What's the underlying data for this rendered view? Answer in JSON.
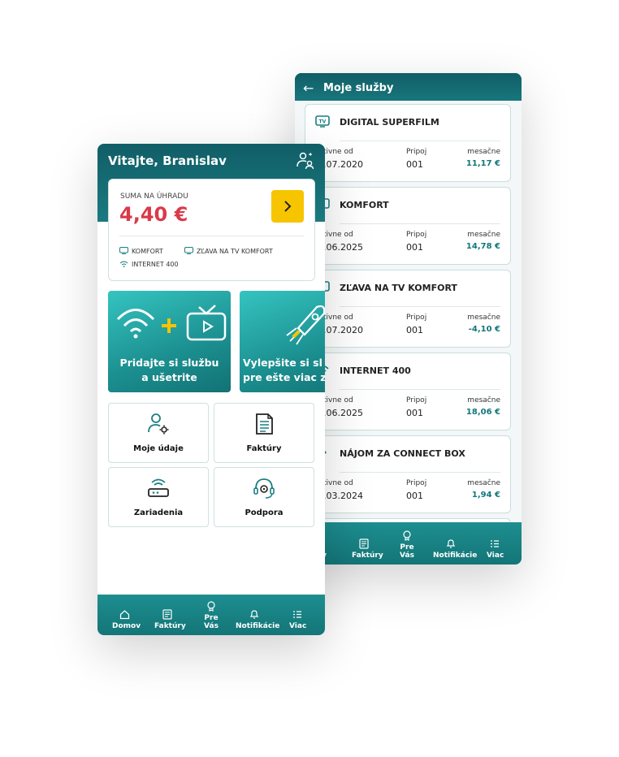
{
  "back": {
    "title": "Moje služby",
    "services": [
      {
        "name": "DIGITAL SUPERFILM",
        "icon": "tv-icon",
        "col1": "tivne od",
        "col1_val": ".07.2020",
        "col2": "Pripoj",
        "col2_val": "001",
        "col3": "mesačne",
        "price": "11,17 €"
      },
      {
        "name": "KOMFORT",
        "icon": "tv-icon",
        "col1": "tivne od",
        "col1_val": ".06.2025",
        "col2": "Pripoj",
        "col2_val": "001",
        "col3": "mesačne",
        "price": "14,78 €"
      },
      {
        "name": "ZĽAVA NA TV KOMFORT",
        "icon": "tv-icon",
        "col1": "tivne od",
        "col1_val": ".07.2020",
        "col2": "Pripoj",
        "col2_val": "001",
        "col3": "mesačne",
        "price": "-4,10 €"
      },
      {
        "name": "INTERNET 400",
        "icon": "wifi-icon",
        "col1": "tivne od",
        "col1_val": ".06.2025",
        "col2": "Pripoj",
        "col2_val": "001",
        "col3": "mesačne",
        "price": "18,06 €"
      },
      {
        "name": "NÁJOM ZA CONNECT BOX",
        "icon": "dot-icon",
        "col1": "tivne od",
        "col1_val": ".03.2024",
        "col2": "Pripoj",
        "col2_val": "001",
        "col3": "mesačne",
        "price": "1,94 €"
      }
    ],
    "nav": [
      "ov",
      "Faktúry",
      "Pre Vás",
      "Notifikácie",
      "Viac"
    ]
  },
  "front": {
    "greeting": "Vitajte, Branislav",
    "sum_label": "SUMA NA ÚHRADU",
    "amount": "4,40 €",
    "chips": [
      {
        "label": "KOMFORT",
        "icon": "tv-icon"
      },
      {
        "label": "ZĽAVA NA TV KOMFORT",
        "icon": "tv-icon"
      },
      {
        "label": "INTERNET 400",
        "icon": "wifi-icon"
      }
    ],
    "promos": [
      {
        "line1": "Pridajte si službu",
        "line2": "a ušetrite"
      },
      {
        "line1": "Vylepšite si sl",
        "line2": "pre ešte viac z"
      }
    ],
    "tiles": [
      "Moje údaje",
      "Faktúry",
      "Zariadenia",
      "Podpora"
    ],
    "nav": [
      "Domov",
      "Faktúry",
      "Pre Vás",
      "Notifikácie",
      "Viac"
    ]
  },
  "colors": {
    "teal": "#155f68",
    "accent_yellow": "#f7c400",
    "amount_red": "#d93a4a",
    "price_teal": "#12767a"
  }
}
